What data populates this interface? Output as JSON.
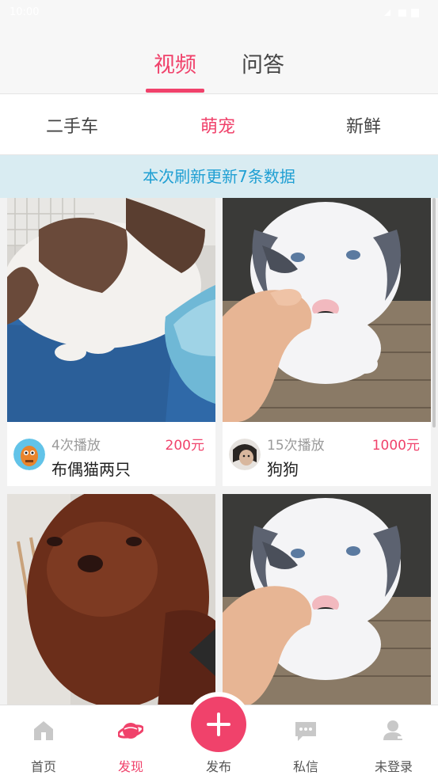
{
  "status_bar": {
    "time": "10:00",
    "signal_icon": "signal-icon",
    "battery_icon": "battery-icon"
  },
  "top_tabs": [
    {
      "label": "视频",
      "active": true
    },
    {
      "label": "问答",
      "active": false
    }
  ],
  "categories": [
    {
      "label": "二手车",
      "active": false
    },
    {
      "label": "萌宠",
      "active": true
    },
    {
      "label": "新鲜",
      "active": false
    }
  ],
  "refresh_banner": "本次刷新更新7条数据",
  "cards": [
    {
      "plays": "4次播放",
      "price": "200元",
      "title": "布偶猫两只",
      "image": "ragdoll-cat-photo"
    },
    {
      "plays": "15次播放",
      "price": "1000元",
      "title": "狗狗",
      "image": "white-puppy-photo"
    },
    {
      "plays": "",
      "price": "",
      "title": "",
      "image": "brown-poodle-photo"
    },
    {
      "plays": "",
      "price": "",
      "title": "",
      "image": "white-puppy-photo"
    }
  ],
  "bottom_nav": [
    {
      "label": "首页",
      "icon": "home-icon",
      "active": false
    },
    {
      "label": "发现",
      "icon": "planet-icon",
      "active": true
    },
    {
      "label": "发布",
      "icon": "plus-icon",
      "active": false
    },
    {
      "label": "私信",
      "icon": "message-icon",
      "active": false
    },
    {
      "label": "未登录",
      "icon": "user-icon",
      "active": false
    }
  ],
  "colors": {
    "accent": "#f0426b",
    "banner_text": "#1f9fd3",
    "banner_bg": "#d9ecf2"
  }
}
